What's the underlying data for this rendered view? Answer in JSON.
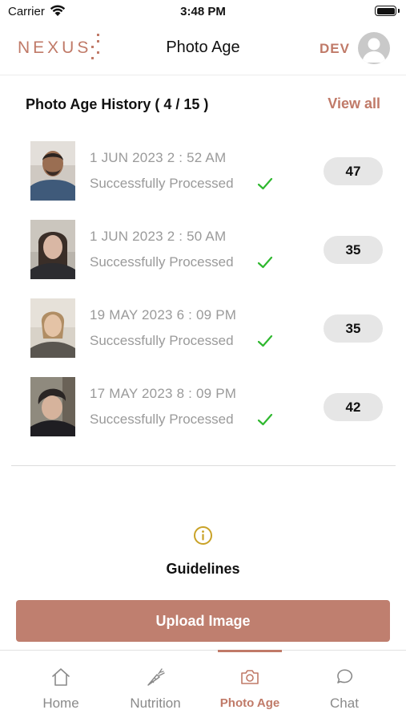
{
  "status_bar": {
    "carrier": "Carrier",
    "time": "3:48 PM"
  },
  "header": {
    "brand": "NEXUS",
    "title": "Photo Age",
    "user": "DEV"
  },
  "history": {
    "title": "Photo Age History ( 4 / 15 )",
    "view_all": "View all",
    "items": [
      {
        "date": "1 JUN 2023   2 : 52 AM",
        "status": "Successfully Processed",
        "age": "47"
      },
      {
        "date": "1 JUN 2023   2 : 50 AM",
        "status": "Successfully Processed",
        "age": "35"
      },
      {
        "date": "19 MAY 2023   6 : 09 PM",
        "status": "Successfully Processed",
        "age": "35"
      },
      {
        "date": "17 MAY 2023   8 : 09 PM",
        "status": "Successfully Processed",
        "age": "42"
      }
    ]
  },
  "guidelines": {
    "label": "Guidelines",
    "icon": "info-icon"
  },
  "upload": {
    "label": "Upload Image"
  },
  "tabs": [
    {
      "label": "Home",
      "icon": "home-icon",
      "active": false
    },
    {
      "label": "Nutrition",
      "icon": "carrot-icon",
      "active": false
    },
    {
      "label": "Photo Age",
      "icon": "camera-icon",
      "active": true
    },
    {
      "label": "Chat",
      "icon": "chat-bubble-icon",
      "active": false
    }
  ],
  "colors": {
    "accent": "#c07a68",
    "button": "#bf7f6f",
    "success": "#2fb82f",
    "muted_text": "#9a9a9a",
    "badge_bg": "#e6e6e6"
  }
}
